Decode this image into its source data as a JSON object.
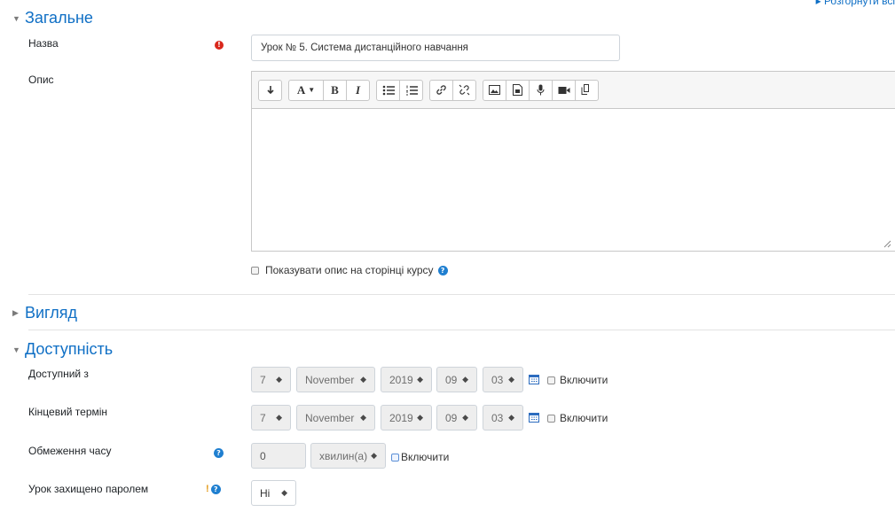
{
  "header": {
    "expand_all": "▸ Розгорнути всі"
  },
  "sections": {
    "general": {
      "title": "Загальне"
    },
    "appearance": {
      "title": "Вигляд"
    },
    "availability": {
      "title": "Доступність"
    }
  },
  "fields": {
    "name": {
      "label": "Назва",
      "value": "Урок № 5. Система дистанційного навчання"
    },
    "description": {
      "label": "Опис",
      "value": ""
    },
    "show_description": {
      "label": "Показувати опис на сторінці курсу"
    },
    "available_from": {
      "label": "Доступний з",
      "day": "7",
      "month": "November",
      "year": "2019",
      "hour": "09",
      "minute": "03",
      "enable": "Включити"
    },
    "deadline": {
      "label": "Кінцевий термін",
      "day": "7",
      "month": "November",
      "year": "2019",
      "hour": "09",
      "minute": "03",
      "enable": "Включити"
    },
    "time_limit": {
      "label": "Обмеження часу",
      "value": "0",
      "unit": "хвилин(а)",
      "enable": "Включити"
    },
    "password": {
      "label": "Урок захищено паролем",
      "value": "Ні"
    }
  },
  "toolbar_icons": [
    "collapse-icon",
    "font-color-icon",
    "bold-icon",
    "italic-icon",
    "unordered-list-icon",
    "ordered-list-icon",
    "link-icon",
    "unlink-icon",
    "image-icon",
    "media-file-icon",
    "record-audio-icon",
    "record-video-icon",
    "manage-files-icon"
  ],
  "colors": {
    "link": "#0f6fc5",
    "required": "#d9281c",
    "help": "#1f7fd0"
  }
}
